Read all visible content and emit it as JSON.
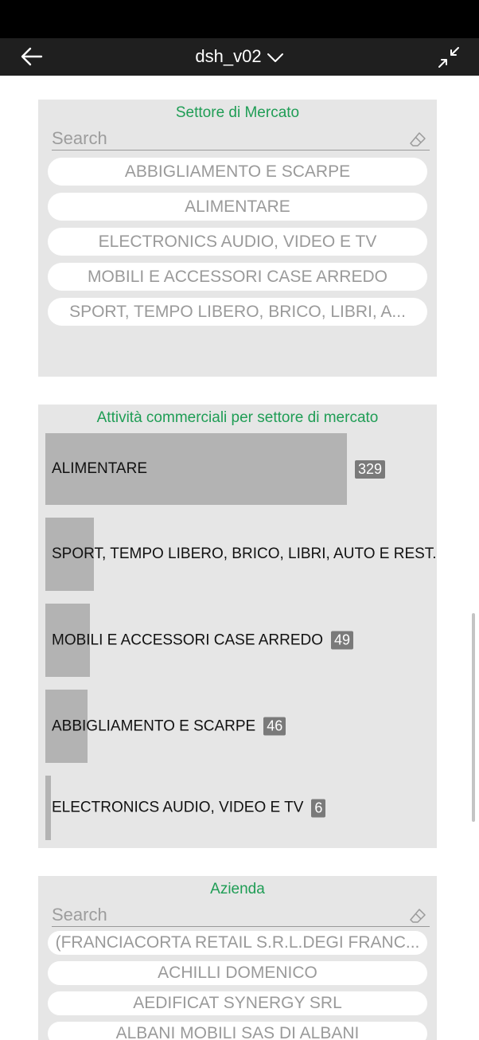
{
  "appbar": {
    "title": "dsh_v02",
    "back_icon": "arrow-left-icon",
    "title_icon": "chevron-down-icon",
    "collapse_icon": "collapse-icon"
  },
  "sector_slicer": {
    "title": "Settore di Mercato",
    "search_placeholder": "Search",
    "items": [
      "ABBIGLIAMENTO E SCARPE",
      "ALIMENTARE",
      "ELECTRONICS AUDIO, VIDEO E TV",
      "MOBILI E ACCESSORI CASE ARREDO",
      "SPORT, TEMPO LIBERO, BRICO, LIBRI, A..."
    ]
  },
  "activity_chart": {
    "title": "Attività commerciali per settore di mercato"
  },
  "chart_data": {
    "type": "bar",
    "orientation": "horizontal",
    "title": "Attività commerciali per settore di mercato",
    "categories": [
      "ALIMENTARE",
      "SPORT, TEMPO LIBERO, BRICO, LIBRI, AUTO E REST.",
      "MOBILI E ACCESSORI CASE ARREDO",
      "ABBIGLIAMENTO E SCARPE",
      "ELECTRONICS AUDIO, VIDEO E TV"
    ],
    "values": [
      329,
      53,
      49,
      46,
      6
    ],
    "data_labels": [
      "329",
      "",
      "49",
      "46",
      "6"
    ],
    "bar_color": "#b3b3b3",
    "label_badge_color": "#7a7a7a",
    "grid": false
  },
  "company_slicer": {
    "title": "Azienda",
    "search_placeholder": "Search",
    "items": [
      "(FRANCIACORTA RETAIL S.R.L.DEGI FRANC...",
      "ACHILLI DOMENICO",
      "AEDIFICAT SYNERGY SRL",
      "ALBANI MOBILI SAS DI ALBANI"
    ]
  },
  "colors": {
    "panel_bg": "#e6e6e6",
    "title_green": "#1f9d55",
    "appbar_bg": "#1f1f1f"
  }
}
